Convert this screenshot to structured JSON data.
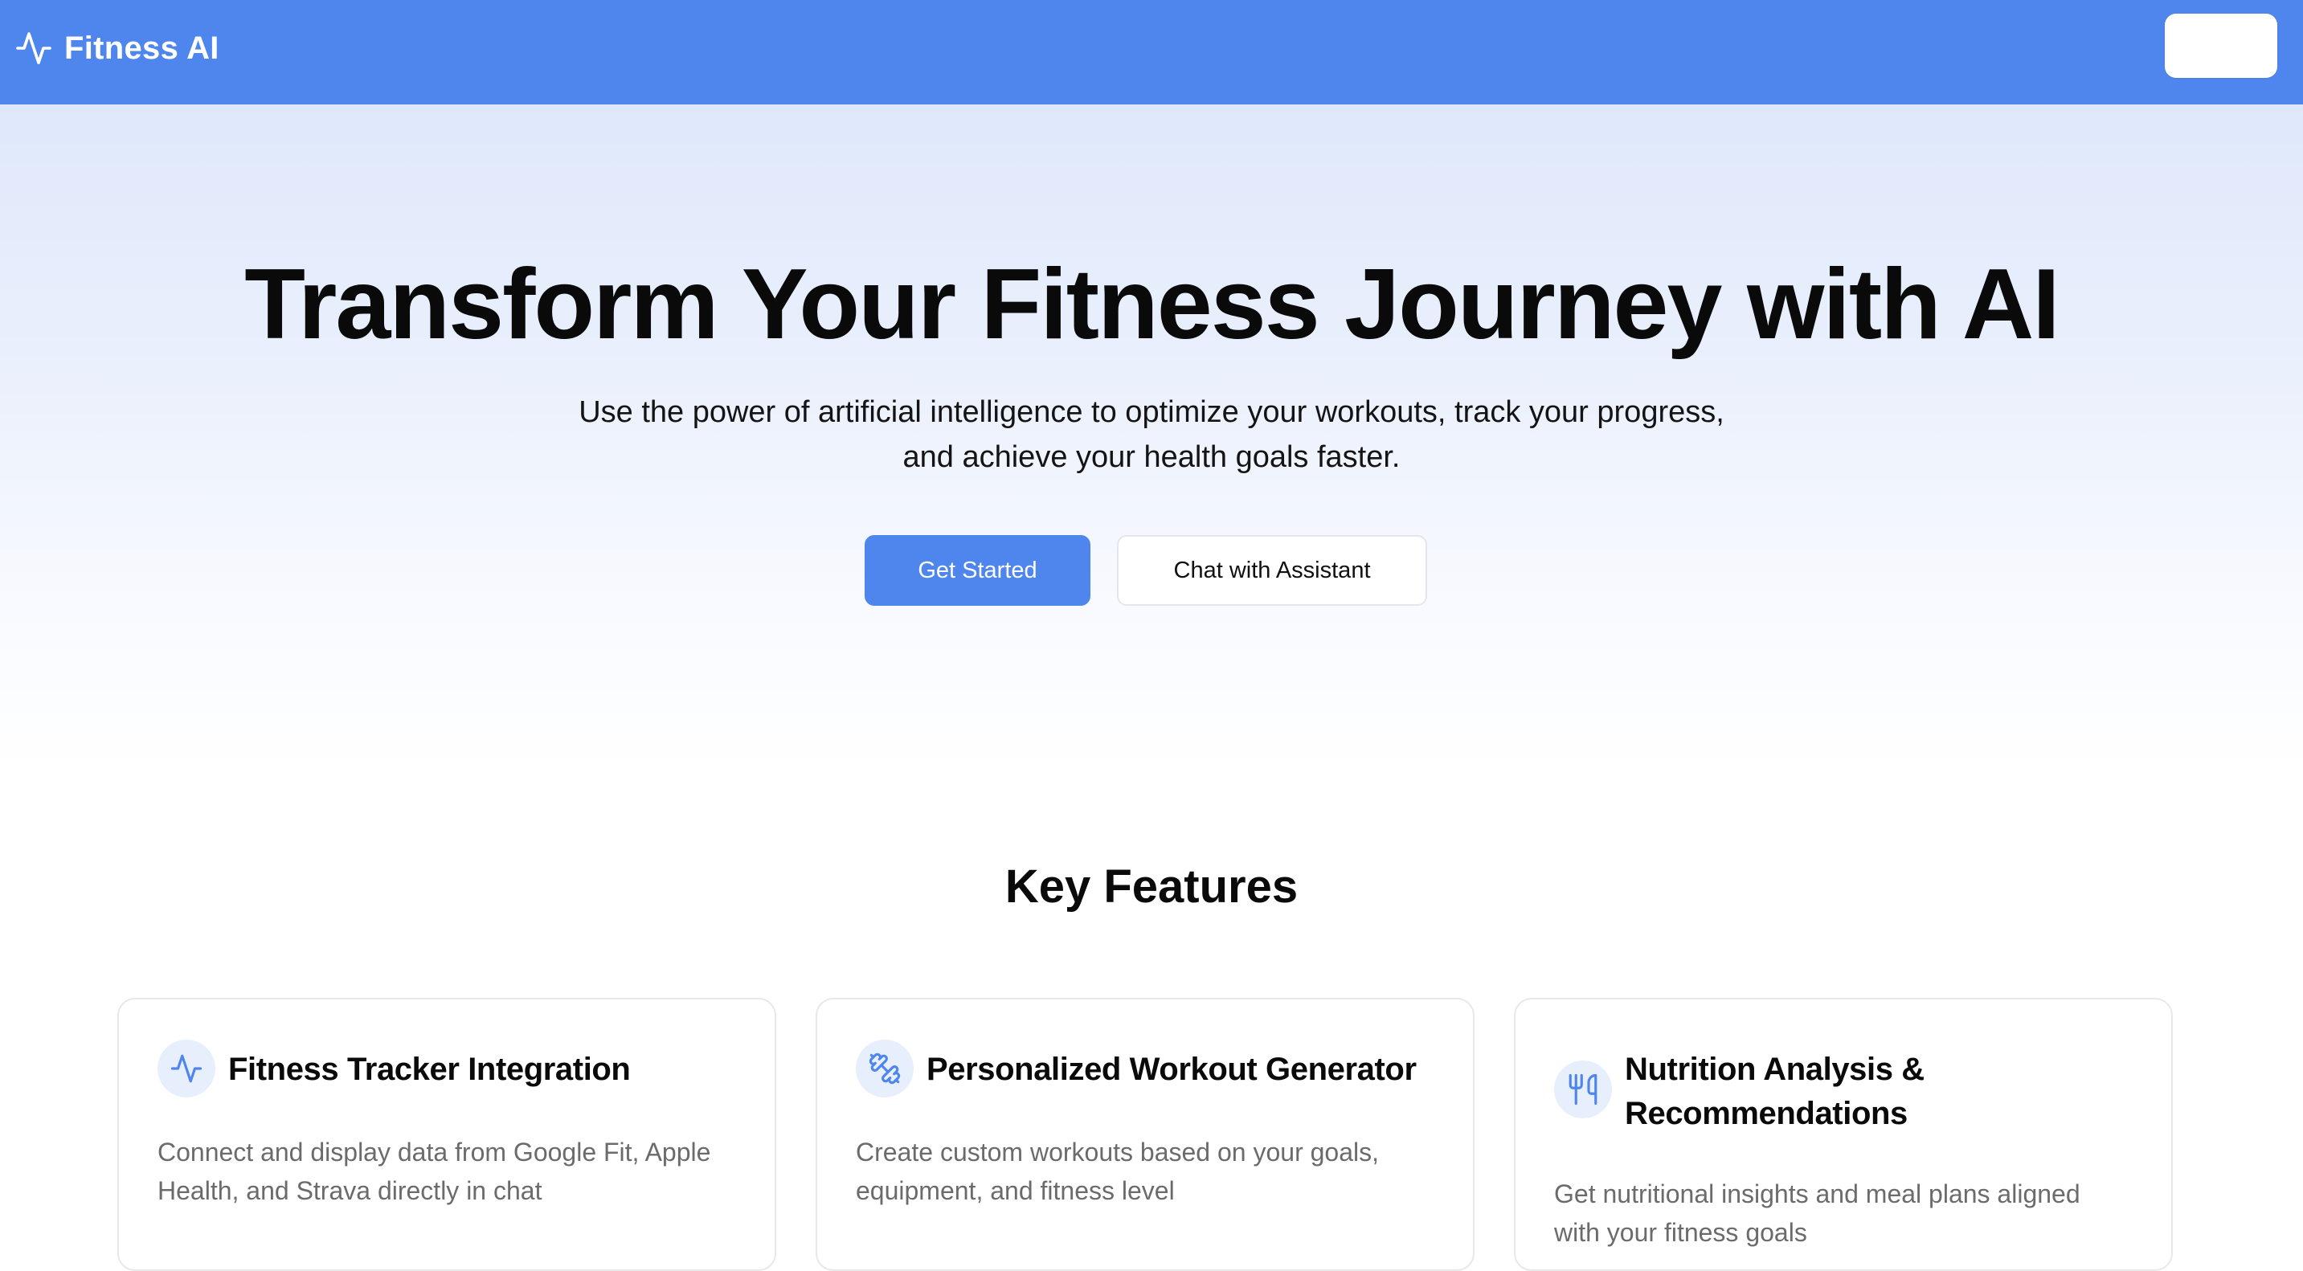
{
  "header": {
    "brand_name": "Fitness AI",
    "brand_icon": "activity-pulse-icon",
    "action_button_label": "",
    "colors": {
      "background": "#4f86ee",
      "text": "#ffffff"
    }
  },
  "hero": {
    "title": "Transform Your Fitness Journey with AI",
    "subtitle_lines": [
      "Use the power of artificial intelligence to optimize your workouts, track your progress,",
      "and achieve your health goals faster."
    ],
    "primary_cta": "Get Started",
    "secondary_cta": "Chat with Assistant"
  },
  "features": {
    "title": "Key Features",
    "cards": [
      {
        "icon": "activity-pulse-icon",
        "title_lines": [
          "Fitness Tracker Integration"
        ],
        "description_lines": [
          "Connect and display data from Google Fit, Apple",
          "Health, and Strava directly in chat"
        ]
      },
      {
        "icon": "dumbbell-icon",
        "title_lines": [
          "Personalized Workout Generator"
        ],
        "description_lines": [
          "Create custom workouts based on your goals,",
          "equipment, and fitness level"
        ]
      },
      {
        "icon": "utensils-icon",
        "title_lines": [
          "Nutrition Analysis &",
          "Recommendations"
        ],
        "description_lines": [
          "Get nutritional insights and meal plans aligned",
          "with your fitness goals"
        ]
      }
    ]
  },
  "theme": {
    "accent": "#4f86ee",
    "text_primary": "#0a0a0a",
    "text_muted": "#6b6b6b",
    "icon_bg": "#e7eefc"
  }
}
